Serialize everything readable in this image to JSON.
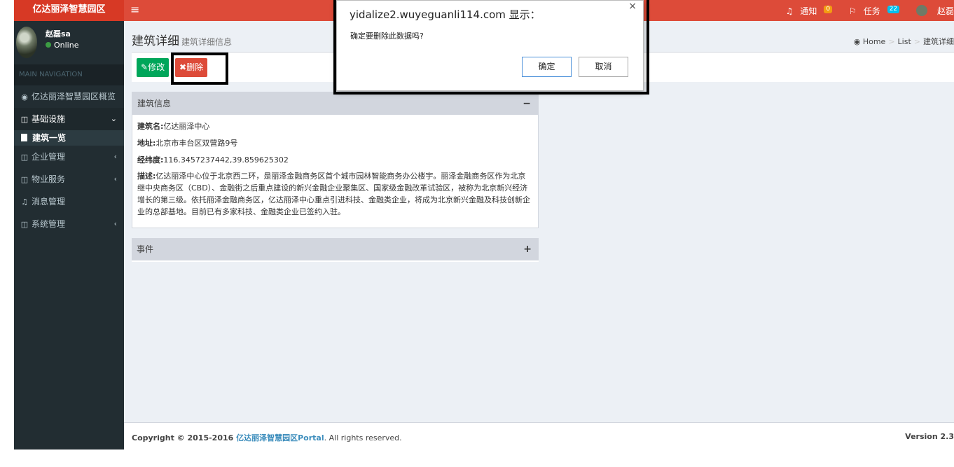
{
  "app": {
    "logo": "亿达丽泽智慧园区"
  },
  "user": {
    "name": "赵磊sa",
    "status": "Online"
  },
  "sidebar": {
    "header": "MAIN NAVIGATION",
    "items": [
      {
        "label": "亿达丽泽智慧园区概览",
        "icon": "dashboard-icon"
      },
      {
        "label": "基础设施",
        "icon": "building-icon",
        "caret": "⌄"
      },
      {
        "label": "建筑一览",
        "icon": "document-icon"
      },
      {
        "label": "企业管理",
        "icon": "building-icon",
        "caret": "‹"
      },
      {
        "label": "物业服务",
        "icon": "building-icon",
        "caret": "‹"
      },
      {
        "label": "消息管理",
        "icon": "bell-icon"
      },
      {
        "label": "系统管理",
        "icon": "building-icon",
        "caret": "‹"
      }
    ]
  },
  "topbar": {
    "menu_icon": "≡",
    "notify_label": "通知",
    "notify_count": "0",
    "task_label": "任务",
    "task_count": "22",
    "user_label": "赵磊"
  },
  "page": {
    "title": "建筑详细",
    "subtitle": "建筑详细信息",
    "breadcrumb": [
      "Home",
      "List",
      "建筑详细"
    ]
  },
  "toolbar": {
    "edit_label": "修改",
    "delete_label": "删除"
  },
  "building_box": {
    "title": "建筑信息",
    "collapse_symbol": "−",
    "name_label": "建筑名:",
    "name_value": "亿达丽泽中心",
    "address_label": "地址:",
    "address_value": "北京市丰台区双营路9号",
    "coords_label": "经纬度:",
    "coords_value": "116.3457237442,39.859625302",
    "desc_label": "描述:",
    "desc_value": "亿达丽泽中心位于北京西二环，是丽泽金融商务区首个城市园林智能商务办公楼宇。丽泽金融商务区作为北京继中央商务区（CBD）、金融街之后重点建设的新兴金融企业聚集区、国家级金融改革试验区，被称为北京新兴经济增长的第三级。依托丽泽金融商务区，亿达丽泽中心重点引进科技、金融类企业，将成为北京新兴金融及科技创新企业的总部基地。目前已有多家科技、金融类企业已签约入驻。"
  },
  "event_box": {
    "title": "事件",
    "expand_symbol": "+"
  },
  "footer": {
    "copyright": "Copyright © 2015-2016 ",
    "brand": "亿达丽泽智慧园区Portal",
    "rights": ". All rights reserved.",
    "version": "Version 2.3"
  },
  "dialog": {
    "title": "yidalize2.wuyeguanli114.com 显示：",
    "message": "确定要删除此数据吗?",
    "ok_label": "确定",
    "cancel_label": "取消",
    "close_symbol": "×"
  }
}
